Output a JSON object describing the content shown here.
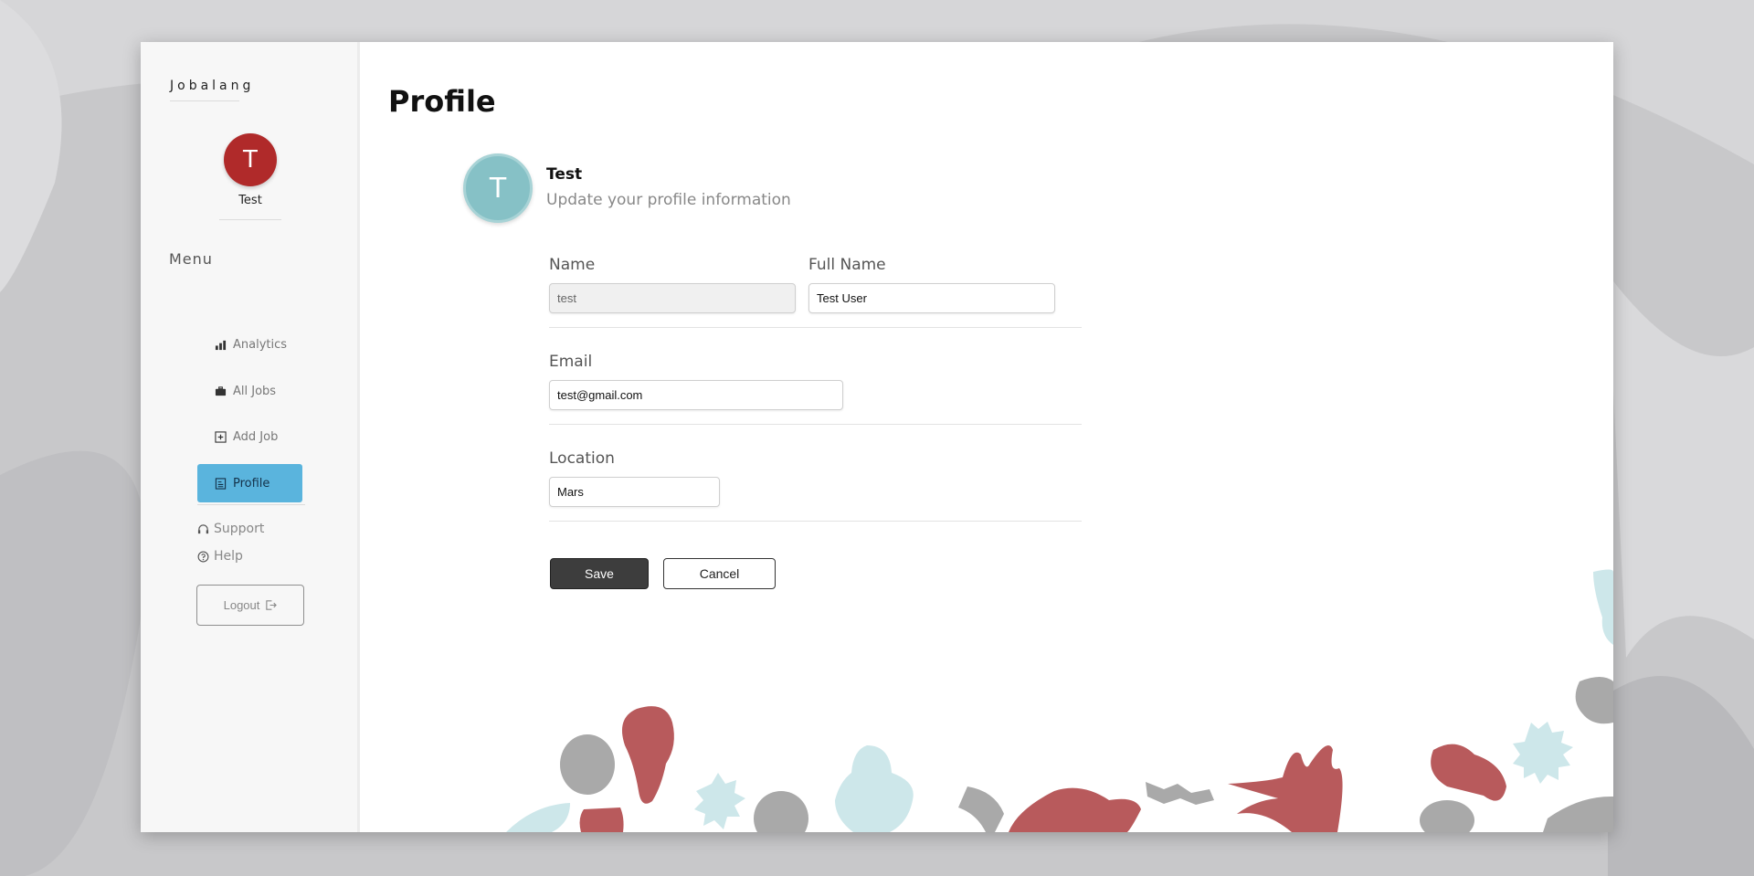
{
  "brand": "Jobalang",
  "user": {
    "initial": "T",
    "name": "Test"
  },
  "sidebar": {
    "menu_title": "Menu",
    "items": [
      {
        "label": "Analytics",
        "icon": "chart-bar-icon"
      },
      {
        "label": "All Jobs",
        "icon": "briefcase-icon"
      },
      {
        "label": "Add Job",
        "icon": "plus-square-icon"
      },
      {
        "label": "Profile",
        "icon": "profile-icon",
        "active": true
      }
    ],
    "support_label": "Support",
    "help_label": "Help",
    "logout_label": "Logout"
  },
  "page": {
    "title": "Profile"
  },
  "profile": {
    "initial": "T",
    "name": "Test",
    "subtitle": "Update your profile information"
  },
  "form": {
    "name_label": "Name",
    "name_value": "test",
    "fullname_label": "Full Name",
    "fullname_value": "Test User",
    "email_label": "Email",
    "email_value": "test@gmail.com",
    "location_label": "Location",
    "location_value": "Mars",
    "save_label": "Save",
    "cancel_label": "Cancel"
  },
  "colors": {
    "accent": "#5ab4dd",
    "avatar_side": "#b02a2a",
    "avatar_main": "#86c1c6",
    "decor_red": "#b85a5c",
    "decor_gray": "#a9a9a9",
    "decor_teal": "#cde7ea"
  }
}
